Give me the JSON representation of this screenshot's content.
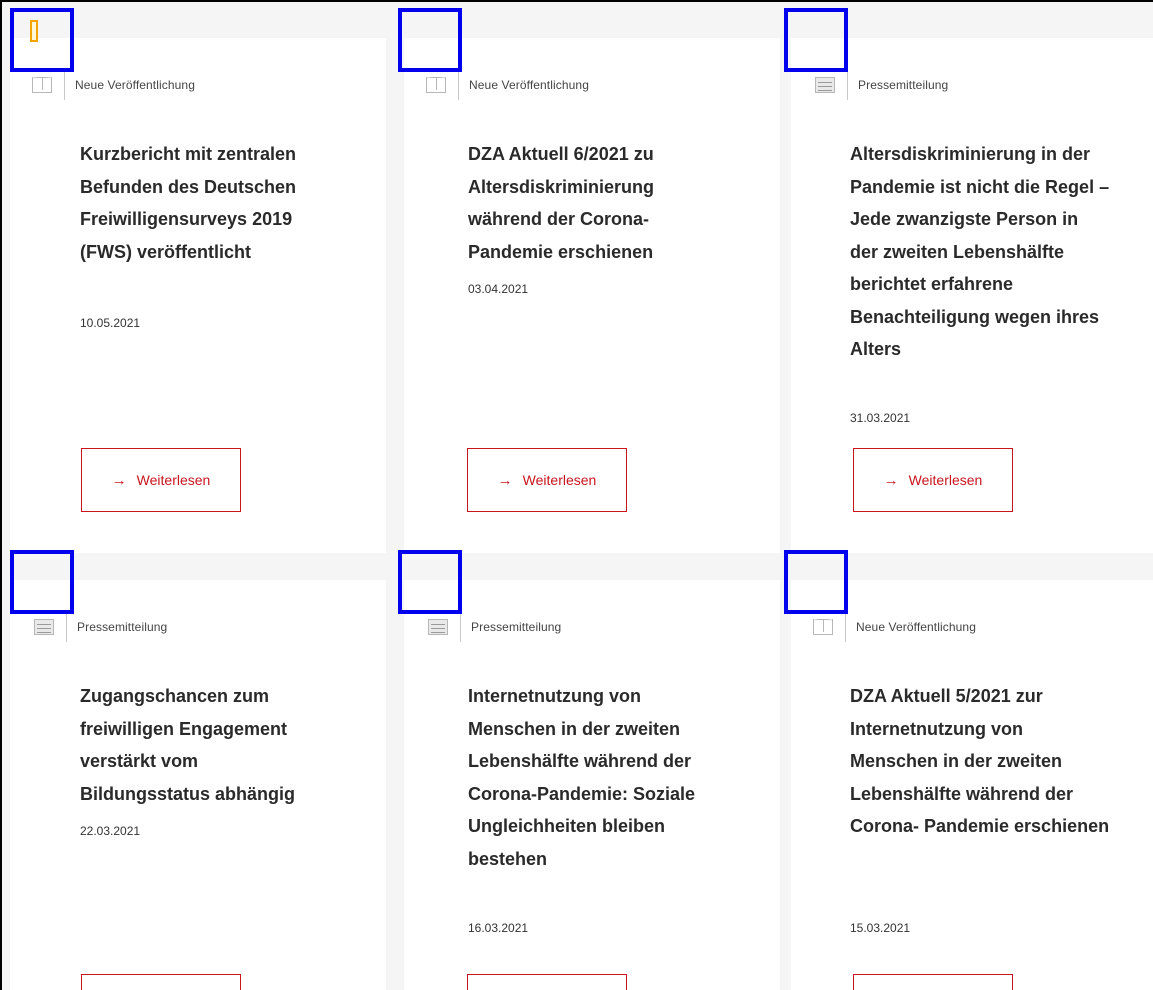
{
  "button_label": "Weiterlesen",
  "button_arrow": "→",
  "colors": {
    "accent": "#c8161d",
    "marker": "#0000ee",
    "bookmark": "#f4a400"
  },
  "cards": [
    {
      "type": "Neue Veröffentlichung",
      "icon": "book-icon",
      "title": "Kurzbericht mit zentralen Befunden des Deutschen Freiwilligensurveys 2019 (FWS) veröffentlicht",
      "date": "10.05.2021"
    },
    {
      "type": "Neue Veröffentlichung",
      "icon": "book-icon",
      "title": "DZA Aktuell 6/2021 zu Altersdiskriminierung während der Corona-Pandemie erschienen",
      "date": "03.04.2021"
    },
    {
      "type": "Pressemitteilung",
      "icon": "document-icon",
      "title": "Altersdiskriminierung in der Pandemie ist nicht die Regel – Jede zwanzigste Person in der zweiten Lebenshälfte berichtet erfahrene Benachteiligung wegen ihres Alters",
      "date": "31.03.2021"
    },
    {
      "type": "Pressemitteilung",
      "icon": "document-icon",
      "title": "Zugangschancen zum freiwilligen Engagement verstärkt vom Bildungsstatus abhängig",
      "date": "22.03.2021"
    },
    {
      "type": "Pressemitteilung",
      "icon": "document-icon",
      "title": "Internetnutzung von Menschen in der zweiten Lebenshälfte während der Corona-Pandemie: Soziale Ungleichheiten bleiben bestehen",
      "date": "16.03.2021"
    },
    {
      "type": "Neue Veröffentlichung",
      "icon": "book-icon",
      "title": "DZA Aktuell 5/2021 zur Internetnutzung von Menschen in der zweiten Lebenshälfte während der Corona- Pandemie erschienen",
      "date": "15.03.2021"
    }
  ]
}
